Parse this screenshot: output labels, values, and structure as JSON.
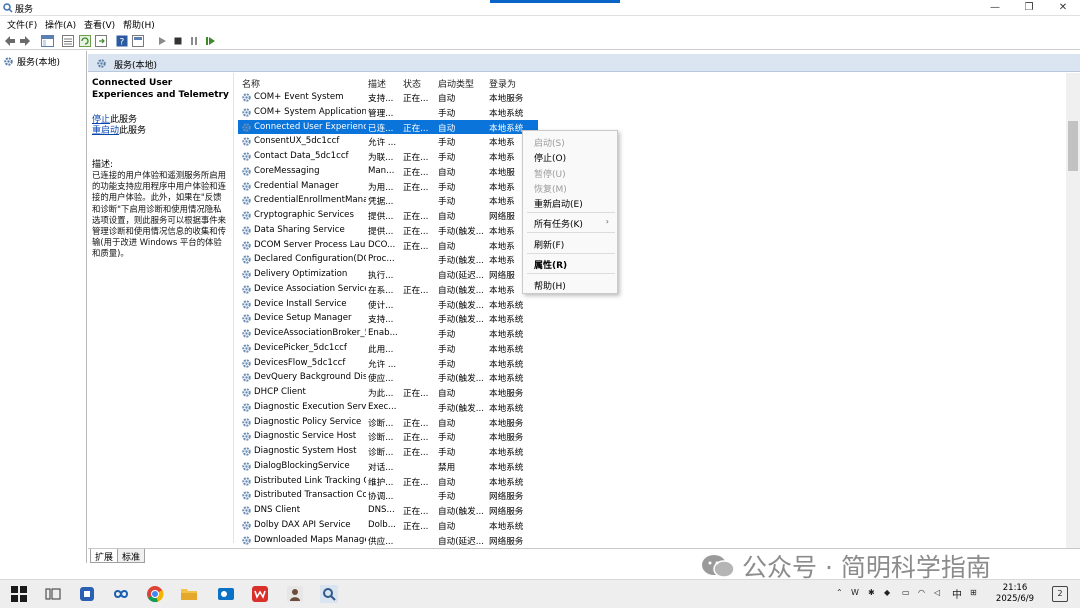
{
  "window": {
    "title": "服务",
    "controls": {
      "minimize": "—",
      "maximize": "❐",
      "close": "✕"
    }
  },
  "menu": [
    "文件(F)",
    "操作(A)",
    "查看(V)",
    "帮助(H)"
  ],
  "tree": {
    "root": "服务(本地)"
  },
  "main": {
    "header": "服务(本地)",
    "selected_service": "Connected User Experiences and Telemetry",
    "action_stop": "停止",
    "action_stop_suffix": "此服务",
    "action_restart": "重启动",
    "action_restart_suffix": "此服务",
    "desc_label": "描述:",
    "desc_text": "已连接的用户体验和遥测服务所启用的功能支持应用程序中用户体验和连接的用户体验。此外，如果在\"反馈和诊断\"下启用诊断和使用情况隐私选项设置，则此服务可以根据事件来管理诊断和使用情况信息的收集和传输(用于改进 Windows 平台的体验和质量)。"
  },
  "columns": {
    "name": "名称",
    "description": "描述",
    "status": "状态",
    "startup": "启动类型",
    "logon": "登录为"
  },
  "services": [
    {
      "name": "COM+ Event System",
      "desc": "支持...",
      "status": "正在...",
      "startup": "自动",
      "logon": "本地服务"
    },
    {
      "name": "COM+ System Application",
      "desc": "管理...",
      "status": "",
      "startup": "手动",
      "logon": "本地系统"
    },
    {
      "name": "Connected User Experienc...",
      "desc": "已连...",
      "status": "正在...",
      "startup": "自动",
      "logon": "本地系统",
      "selected": true
    },
    {
      "name": "ConsentUX_5dc1ccf",
      "desc": "允许 ...",
      "status": "",
      "startup": "手动",
      "logon": "本地系"
    },
    {
      "name": "Contact Data_5dc1ccf",
      "desc": "为联...",
      "status": "正在...",
      "startup": "手动",
      "logon": "本地系"
    },
    {
      "name": "CoreMessaging",
      "desc": "Man...",
      "status": "正在...",
      "startup": "自动",
      "logon": "本地服"
    },
    {
      "name": "Credential Manager",
      "desc": "为用...",
      "status": "正在...",
      "startup": "手动",
      "logon": "本地系"
    },
    {
      "name": "CredentialEnrollmentMana...",
      "desc": "凭据...",
      "status": "",
      "startup": "手动",
      "logon": "本地系"
    },
    {
      "name": "Cryptographic Services",
      "desc": "提供...",
      "status": "正在...",
      "startup": "自动",
      "logon": "网络服"
    },
    {
      "name": "Data Sharing Service",
      "desc": "提供...",
      "status": "正在...",
      "startup": "手动(触发...",
      "logon": "本地系"
    },
    {
      "name": "DCOM Server Process Lau...",
      "desc": "DCO...",
      "status": "正在...",
      "startup": "自动",
      "logon": "本地系"
    },
    {
      "name": "Declared Configuration(DC...",
      "desc": "Proc...",
      "status": "",
      "startup": "手动(触发...",
      "logon": "本地系"
    },
    {
      "name": "Delivery Optimization",
      "desc": "执行...",
      "status": "",
      "startup": "自动(延迟...",
      "logon": "网络服"
    },
    {
      "name": "Device Association Service",
      "desc": "在系...",
      "status": "正在...",
      "startup": "自动(触发...",
      "logon": "本地系"
    },
    {
      "name": "Device Install Service",
      "desc": "使计...",
      "status": "",
      "startup": "手动(触发...",
      "logon": "本地系统"
    },
    {
      "name": "Device Setup Manager",
      "desc": "支持...",
      "status": "",
      "startup": "手动(触发...",
      "logon": "本地系统"
    },
    {
      "name": "DeviceAssociationBroker_5...",
      "desc": "Enab...",
      "status": "",
      "startup": "手动",
      "logon": "本地系统"
    },
    {
      "name": "DevicePicker_5dc1ccf",
      "desc": "此用...",
      "status": "",
      "startup": "手动",
      "logon": "本地系统"
    },
    {
      "name": "DevicesFlow_5dc1ccf",
      "desc": "允许 ...",
      "status": "",
      "startup": "手动",
      "logon": "本地系统"
    },
    {
      "name": "DevQuery Background Dis...",
      "desc": "使应...",
      "status": "",
      "startup": "手动(触发...",
      "logon": "本地系统"
    },
    {
      "name": "DHCP Client",
      "desc": "为此...",
      "status": "正在...",
      "startup": "自动",
      "logon": "本地服务"
    },
    {
      "name": "Diagnostic Execution Service",
      "desc": "Exec...",
      "status": "",
      "startup": "手动(触发...",
      "logon": "本地系统"
    },
    {
      "name": "Diagnostic Policy Service",
      "desc": "诊断...",
      "status": "正在...",
      "startup": "自动",
      "logon": "本地服务"
    },
    {
      "name": "Diagnostic Service Host",
      "desc": "诊断...",
      "status": "正在...",
      "startup": "手动",
      "logon": "本地服务"
    },
    {
      "name": "Diagnostic System Host",
      "desc": "诊断...",
      "status": "正在...",
      "startup": "手动",
      "logon": "本地系统"
    },
    {
      "name": "DialogBlockingService",
      "desc": "对话...",
      "status": "",
      "startup": "禁用",
      "logon": "本地系统"
    },
    {
      "name": "Distributed Link Tracking C...",
      "desc": "维护...",
      "status": "正在...",
      "startup": "自动",
      "logon": "本地系统"
    },
    {
      "name": "Distributed Transaction Co...",
      "desc": "协调...",
      "status": "",
      "startup": "手动",
      "logon": "网络服务"
    },
    {
      "name": "DNS Client",
      "desc": "DNS...",
      "status": "正在...",
      "startup": "自动(触发...",
      "logon": "网络服务"
    },
    {
      "name": "Dolby DAX API Service",
      "desc": "Dolb...",
      "status": "正在...",
      "startup": "自动",
      "logon": "本地系统"
    },
    {
      "name": "Downloaded Maps Manager",
      "desc": "供应...",
      "status": "",
      "startup": "自动(延迟...",
      "logon": "网络服务"
    }
  ],
  "context_menu": {
    "start": "启动(S)",
    "stop": "停止(O)",
    "pause": "暂停(U)",
    "resume": "恢复(M)",
    "restart": "重新启动(E)",
    "all_tasks": "所有任务(K)",
    "refresh": "刷新(F)",
    "properties": "属性(R)",
    "help": "帮助(H)"
  },
  "tabs": {
    "extended": "扩展",
    "standard": "标准"
  },
  "watermark": "公众号 · 简明科学指南",
  "taskbar": {
    "ime": "中",
    "time": "21:16",
    "date": "2025/6/9",
    "notifications": "2"
  }
}
